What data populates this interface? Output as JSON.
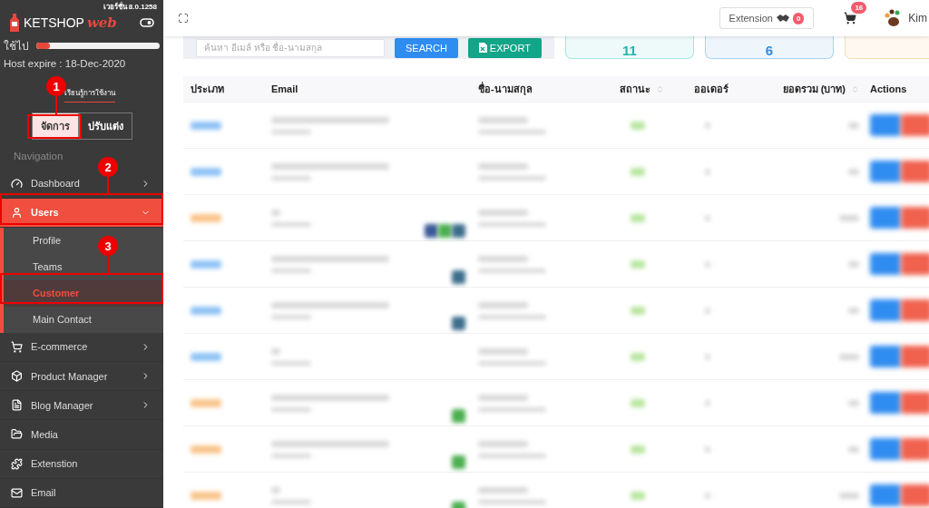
{
  "sidebar": {
    "version": "เวอร์ชั่น 8.0.1258",
    "logo": {
      "main": "KETSHOP",
      "accent": "web"
    },
    "usage": {
      "label": "ใช้ไป",
      "level": 0.11
    },
    "host_expire": "Host expire : 18-Dec-2020",
    "guide_link": "เรียนรู้การใช้งาน",
    "mode_buttons": [
      {
        "label": "จัดการ",
        "selected": true
      },
      {
        "label": "ปรับแต่ง",
        "selected": false
      }
    ],
    "section": "Navigation",
    "items": [
      {
        "label": "Dashboard",
        "kind": "gauge",
        "expanded": false,
        "has_children": true,
        "selected": false
      },
      {
        "label": "Users",
        "kind": "user",
        "expanded": true,
        "has_children": true,
        "selected": true,
        "children": [
          {
            "label": "Profile",
            "selected": false
          },
          {
            "label": "Teams",
            "selected": false
          },
          {
            "label": "Customer",
            "selected": true
          },
          {
            "label": "Main Contact",
            "selected": false
          }
        ]
      },
      {
        "label": "E-commerce",
        "kind": "cart",
        "expanded": false,
        "has_children": true,
        "selected": false
      },
      {
        "label": "Product Manager",
        "kind": "box",
        "expanded": false,
        "has_children": true,
        "selected": false
      },
      {
        "label": "Blog Manager",
        "kind": "blog",
        "expanded": false,
        "has_children": true,
        "selected": false
      },
      {
        "label": "Media",
        "kind": "folder",
        "has_children": false,
        "selected": false
      },
      {
        "label": "Extenstion",
        "kind": "puzzle",
        "has_children": false,
        "selected": false
      },
      {
        "label": "Email",
        "kind": "mail",
        "has_children": false,
        "selected": false
      }
    ]
  },
  "annotations": [
    {
      "label": "1"
    },
    {
      "label": "2"
    },
    {
      "label": "3"
    }
  ],
  "header": {
    "extension": {
      "label": "Extension",
      "count": "0"
    },
    "cart_count": "16",
    "user": "Kim"
  },
  "search": {
    "placeholder": "ค้นหา อีเมล์ หรือ ชื่อ-นามสกุล",
    "search_button": "SEARCH",
    "export_button": "EXPORT"
  },
  "stats": [
    {
      "value": "11",
      "color": "#a6e6df"
    },
    {
      "value": "6",
      "color": "#a9d3f2"
    },
    {
      "color": "#f8ddb4"
    }
  ],
  "table": {
    "columns": [
      {
        "label": "ประเภท",
        "sortable": false
      },
      {
        "label": "Email",
        "sortable": false
      },
      {
        "label": "ชื่อ-นามสกุล",
        "sortable": false
      },
      {
        "label": "สถานะ",
        "sortable": true
      },
      {
        "label": "ออเดอร์",
        "sortable": false
      },
      {
        "label": "ยอดรวม (บาท)",
        "sortable": true
      },
      {
        "label": "Actions",
        "sortable": false
      }
    ],
    "rows": [
      {
        "color": "#8ec2f5",
        "social": []
      },
      {
        "color": "#8ec2f5",
        "social": []
      },
      {
        "color": "#f9c48a",
        "social": [
          {
            "color": "#3b5998"
          },
          {
            "color": "#4caf50"
          },
          {
            "color": "#3d6e8c"
          }
        ]
      },
      {
        "color": "#8ec2f5",
        "social": [
          {
            "color": "#3d6e8c"
          }
        ]
      },
      {
        "color": "#8ec2f5",
        "social": [
          {
            "color": "#3d6e8c"
          }
        ]
      },
      {
        "color": "#8ec2f5",
        "social": []
      },
      {
        "color": "#f9c48a",
        "social": [
          {
            "color": "#4caf50"
          }
        ]
      },
      {
        "color": "#f9c48a",
        "social": [
          {
            "color": "#4caf50"
          }
        ]
      },
      {
        "color": "#f9c48a",
        "social": [
          {
            "color": "#4caf50"
          }
        ]
      }
    ]
  }
}
